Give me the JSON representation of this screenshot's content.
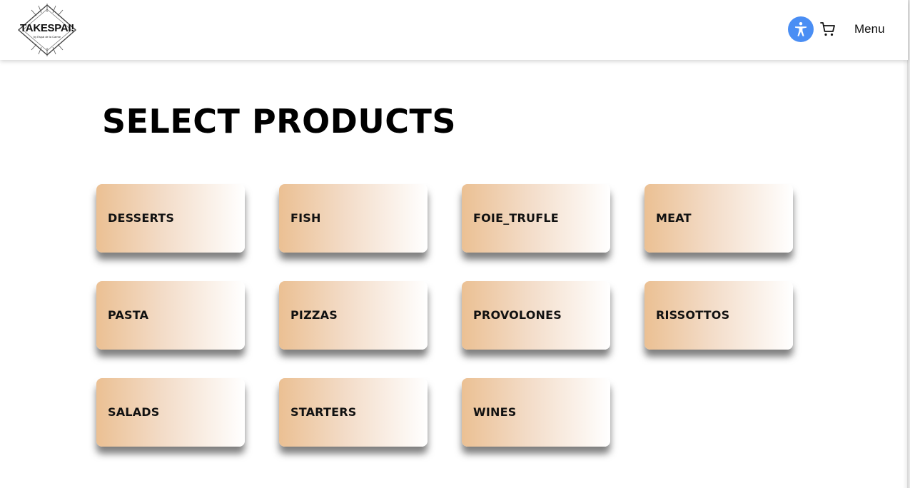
{
  "header": {
    "logo_text": "TAKESPAI!",
    "logo_subtext": "by Espai de la Carme",
    "accessibility_icon": "accessibility-icon",
    "cart_icon": "cart-icon",
    "menu_label": "Menu"
  },
  "main": {
    "title": "SELECT PRODUCTS",
    "categories": [
      "DESSERTS",
      "FISH",
      "FOIE_TRUFLE",
      "MEAT",
      "PASTA",
      "PIZZAS",
      "PROVOLONES",
      "RISSOTTOS",
      "SALADS",
      "STARTERS",
      "WINES"
    ]
  },
  "colors": {
    "accessibility_button": "#4a8ef4",
    "card_gradient_start": "#ebc093",
    "card_gradient_end": "#ffffff"
  }
}
